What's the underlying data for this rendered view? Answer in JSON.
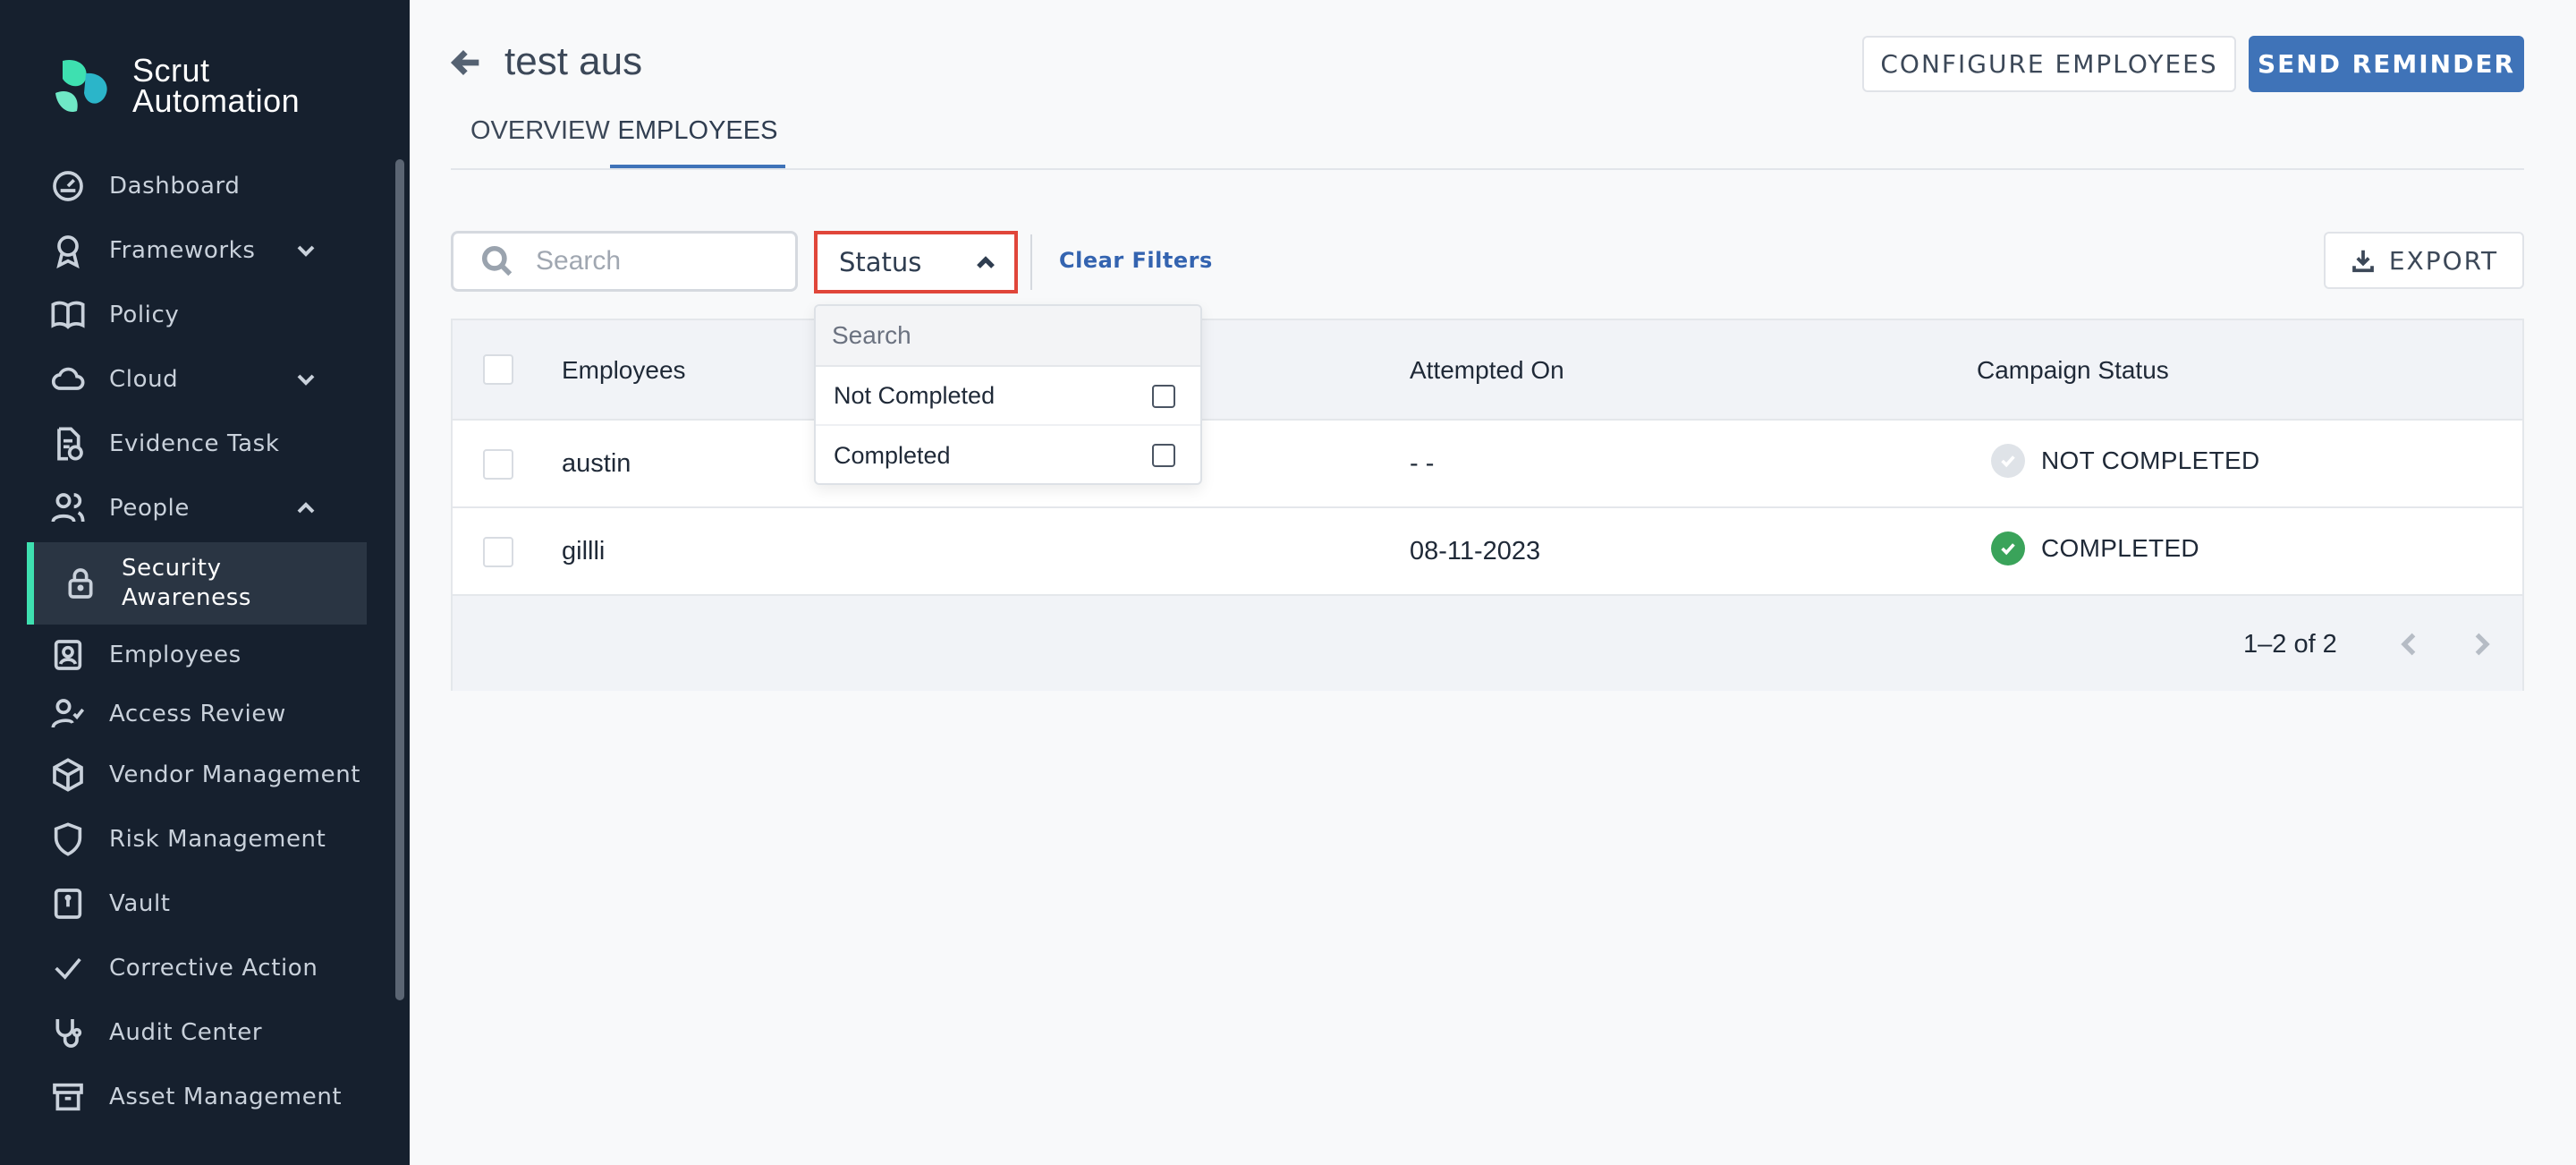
{
  "app": {
    "logo_line1": "Scrut",
    "logo_line2": "Automation",
    "brand_color": "#3ee0b0",
    "sidebar_bg": "#16202e",
    "primary_color": "#3f73b8"
  },
  "sidebar": {
    "items": [
      {
        "label": "Dashboard",
        "icon": "dashboard-icon"
      },
      {
        "label": "Frameworks",
        "icon": "award-icon",
        "expandable": true
      },
      {
        "label": "Policy",
        "icon": "book-icon"
      },
      {
        "label": "Cloud",
        "icon": "cloud-icon",
        "expandable": true
      },
      {
        "label": "Evidence Task",
        "icon": "document-check-icon"
      },
      {
        "label": "People",
        "icon": "people-icon",
        "expanded": true
      },
      {
        "label_line1": "Security",
        "label_line2": "Awareness",
        "icon": "lock-icon",
        "active": true
      },
      {
        "label": "Employees",
        "icon": "employee-badge-icon"
      },
      {
        "label": "Access Review",
        "icon": "user-check-icon"
      },
      {
        "label": "Vendor Management",
        "icon": "box-icon"
      },
      {
        "label": "Risk Management",
        "icon": "shield-icon"
      },
      {
        "label": "Vault",
        "icon": "vault-icon"
      },
      {
        "label": "Corrective Action",
        "icon": "check-icon"
      },
      {
        "label": "Audit Center",
        "icon": "stethoscope-icon"
      },
      {
        "label": "Asset Management",
        "icon": "archive-icon"
      }
    ]
  },
  "header": {
    "title": "test aus",
    "configure_label": "CONFIGURE EMPLOYEES",
    "reminder_label": "SEND REMINDER"
  },
  "tabs": [
    {
      "label": "OVERVIEW",
      "active": false
    },
    {
      "label": "EMPLOYEES",
      "active": true
    }
  ],
  "filters": {
    "search_placeholder": "Search",
    "status_label": "Status",
    "clear_label": "Clear Filters",
    "export_label": "EXPORT"
  },
  "dropdown": {
    "search_placeholder": "Search",
    "options": [
      {
        "label": "Not Completed",
        "checked": false
      },
      {
        "label": "Completed",
        "checked": false
      }
    ]
  },
  "table": {
    "columns": [
      "Employees",
      "Attempted On",
      "Campaign Status"
    ],
    "rows": [
      {
        "employee": "austin",
        "attempted_on": "- -",
        "status": "NOT COMPLETED",
        "status_color": "#dfe3e8"
      },
      {
        "employee": "gillli",
        "attempted_on": "08-11-2023",
        "status": "COMPLETED",
        "status_color": "#3aa35a"
      }
    ],
    "pagination": "1–2 of 2"
  }
}
